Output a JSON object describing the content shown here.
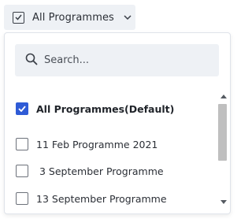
{
  "trigger": {
    "label": "All Programmes",
    "check_icon": "checkbox-icon",
    "chevron_icon": "chevron-down-icon"
  },
  "search": {
    "placeholder": "Search...",
    "value": "",
    "icon": "search-icon"
  },
  "options": [
    {
      "label": "All Programmes(Default)",
      "checked": true
    },
    {
      "label": "11 Feb Programme 2021",
      "checked": false
    },
    {
      "label": " 3 September Programme",
      "checked": false
    },
    {
      "label": "13 September Programme",
      "checked": false
    }
  ],
  "colors": {
    "accent": "#2f5bd6",
    "surface": "#eef1f5",
    "text": "#2b2f36"
  }
}
